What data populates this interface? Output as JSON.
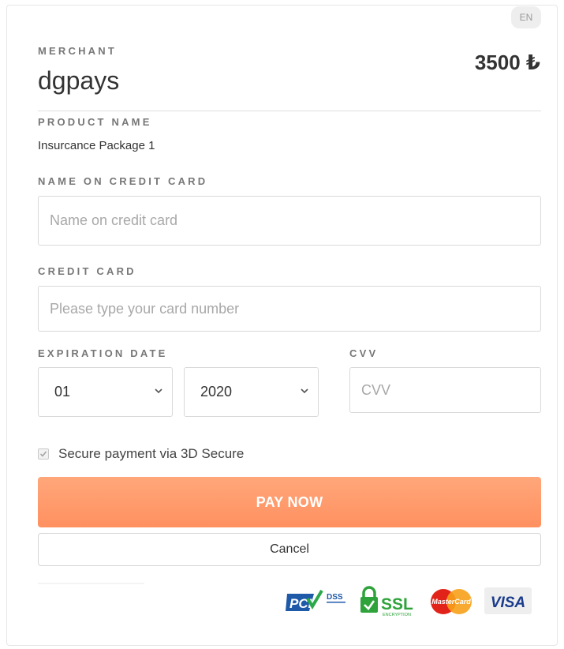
{
  "language": {
    "label": "EN"
  },
  "merchant": {
    "label": "MERCHANT",
    "name": "dgpays",
    "amount": "3500 ₺"
  },
  "product": {
    "label": "PRODUCT NAME",
    "value": "Insurcance Package 1"
  },
  "card_name": {
    "label": "NAME ON CREDIT CARD",
    "placeholder": "Name on credit card"
  },
  "card_number": {
    "label": "CREDIT CARD",
    "placeholder": "Please type your card number"
  },
  "expiration": {
    "label": "EXPIRATION DATE",
    "month": "01",
    "year": "2020"
  },
  "cvv": {
    "label": "CVV",
    "placeholder": "CVV"
  },
  "secure": {
    "label": "Secure payment via 3D Secure",
    "checked": true
  },
  "actions": {
    "pay": "PAY NOW",
    "cancel": "Cancel"
  },
  "logos": {
    "pci": {
      "main": "PCI",
      "sub": "DSS"
    },
    "ssl": {
      "main": "SSL",
      "sub": "ENCRYPTION"
    },
    "mastercard": {
      "main": "MasterCard"
    },
    "visa": {
      "main": "VISA"
    }
  },
  "colors": {
    "accent": "#ff9a6a",
    "pci_blue": "#1e5aa8",
    "pci_green": "#2aa84a",
    "ssl_green": "#2fa33b",
    "mc_red": "#e2231a",
    "mc_orange": "#f7a11a",
    "visa_blue": "#1a3b8c"
  },
  "icons": {
    "chevron": "chevron-down-icon",
    "check": "check-icon",
    "lock": "lock-icon"
  }
}
